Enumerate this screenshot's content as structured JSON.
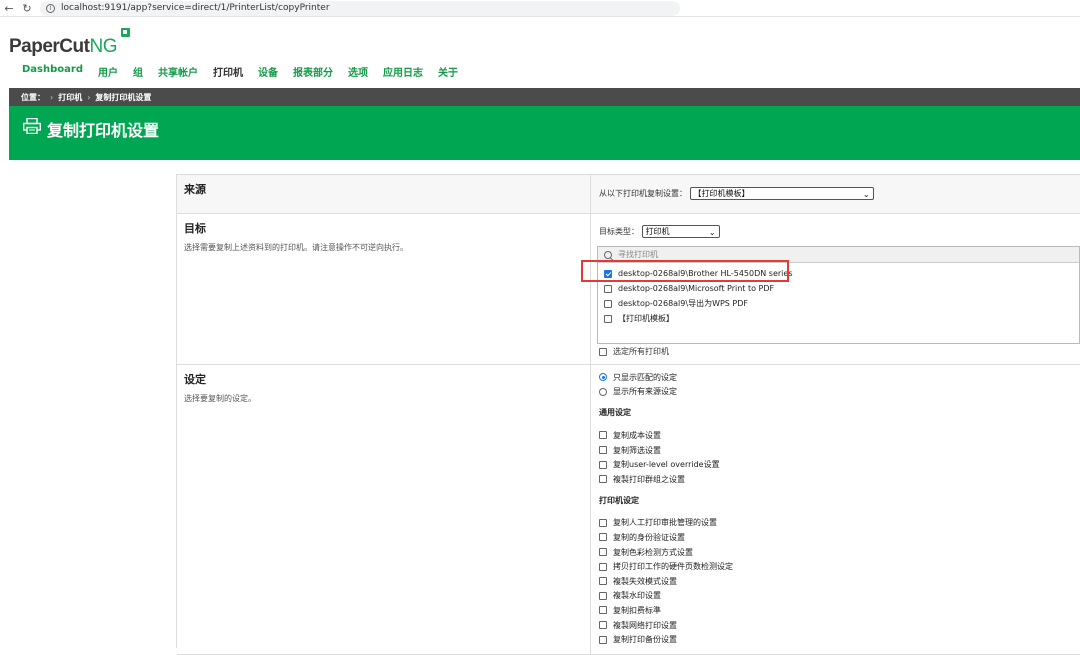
{
  "browser": {
    "url": "localhost:9191/app?service=direct/1/PrinterList/copyPrinter"
  },
  "brand": {
    "paper": "PaperCut",
    "ng": "NG"
  },
  "nav": {
    "items": [
      "Dashboard",
      "用户",
      "组",
      "共享帐户",
      "打印机",
      "设备",
      "报表部分",
      "选项",
      "应用日志",
      "关于"
    ],
    "active_index": 4
  },
  "breadcrumb": {
    "label": "位置：",
    "item1": "打印机",
    "item2": "复制打印机设置"
  },
  "page": {
    "title": "复制打印机设置"
  },
  "source": {
    "title": "来源",
    "copy_from_label": "从以下打印机复制设置：",
    "selected": "【打印机模板】"
  },
  "target": {
    "title": "目标",
    "desc": "选择需要复制上述资料到的打印机。请注意操作不可逆向执行。",
    "type_label": "目标类型：",
    "type_value": "打印机",
    "search_placeholder": "寻找打印机",
    "printers": [
      {
        "name": "desktop-0268al9\\Brother HL-5450DN series",
        "checked": true
      },
      {
        "name": "desktop-0268al9\\Microsoft Print to PDF",
        "checked": false
      },
      {
        "name": "desktop-0268al9\\导出为WPS PDF",
        "checked": false
      },
      {
        "name": "【打印机模板】",
        "checked": false
      }
    ],
    "select_all": "选定所有打印机"
  },
  "settings": {
    "title": "设定",
    "desc": "选择要复制的设定。",
    "radio_matching": "只显示匹配的设定",
    "radio_all": "显示所有来源设定",
    "general_head": "通用设定",
    "general": [
      "复制成本设置",
      "复制筛选设置",
      "复制user-level override设置",
      "複製打印群组之设置"
    ],
    "printer_head": "打印机设定",
    "printer": [
      "复制人工打印审批管理的设置",
      "复制的身份验证设置",
      "复制色彩检测方式设置",
      "拷贝打印工作的硬件页数检测设定",
      "複製失效模式设置",
      "複製水印设置",
      "复制扣费标準",
      "複製网络打印设置",
      "复制打印备份设置"
    ]
  },
  "colors": {
    "green": "#00a651",
    "nav_green": "#159a48",
    "highlight": "#e53935",
    "dark_bar": "#4b4b4b"
  }
}
